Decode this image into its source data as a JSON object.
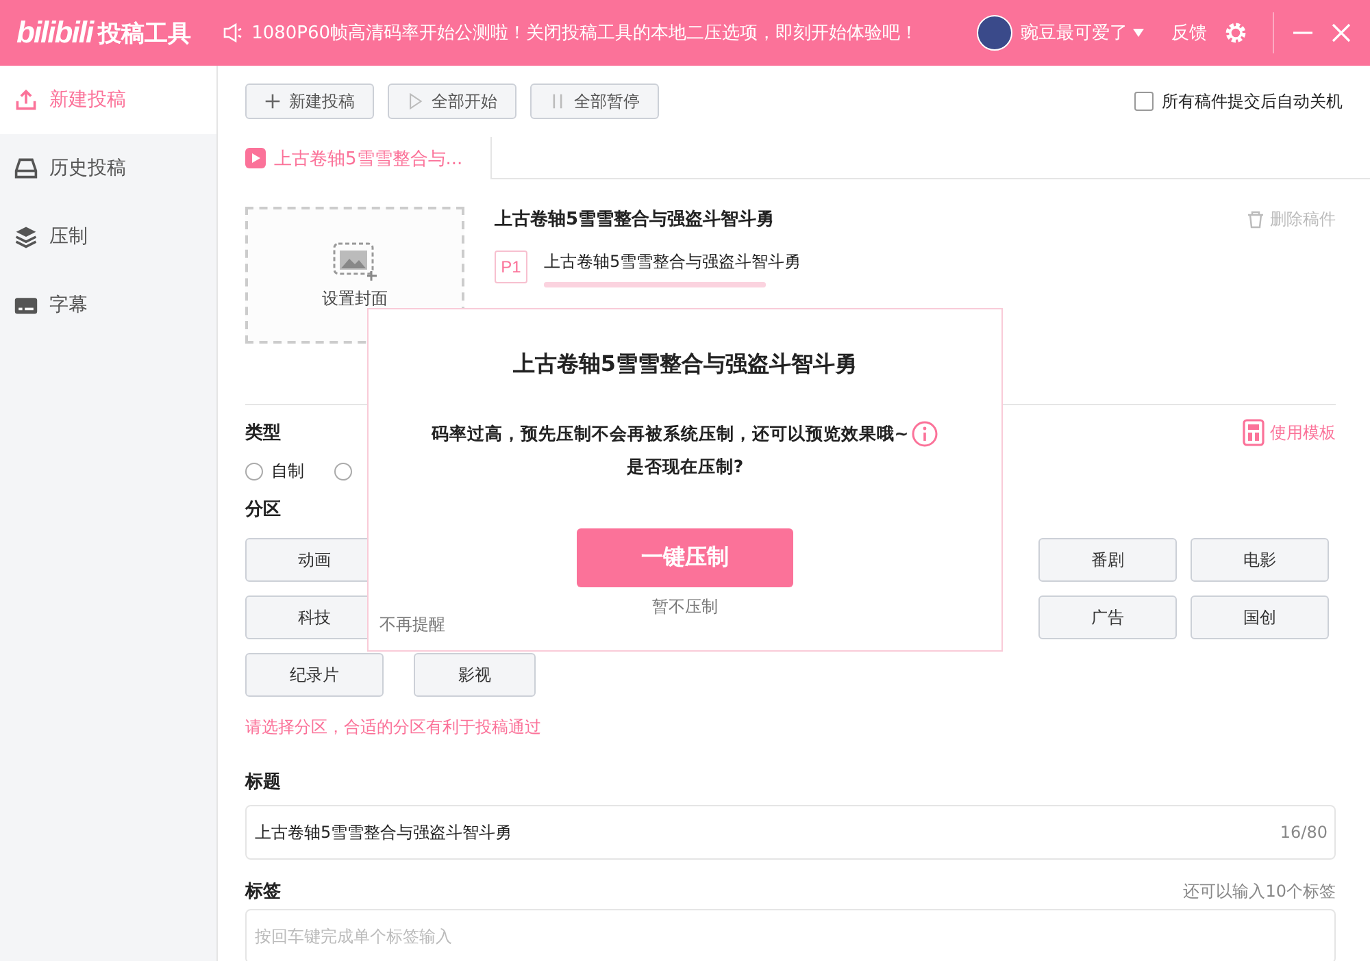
{
  "app": {
    "logo": "bilibili",
    "title": "投稿工具"
  },
  "notice": "1080P60帧高清码率开始公测啦！关闭投稿工具的本地二压选项，即刻开始体验吧！",
  "user": {
    "name": "豌豆最可爱了"
  },
  "feedback": "反馈",
  "sidebar": {
    "items": [
      {
        "label": "新建投稿",
        "selected": true
      },
      {
        "label": "历史投稿",
        "selected": false
      },
      {
        "label": "压制",
        "selected": false
      },
      {
        "label": "字幕",
        "selected": false
      }
    ]
  },
  "toolbar": {
    "buttons": [
      {
        "label": "新建投稿"
      },
      {
        "label": "全部开始"
      },
      {
        "label": "全部暂停"
      }
    ],
    "auto_shutdown": {
      "label": "所有稿件提交后自动关机",
      "checked": false
    }
  },
  "tabs": [
    {
      "label": "上古卷轴5雪雪整合与...",
      "selected": true
    }
  ],
  "draft": {
    "cover_label": "设置封面",
    "title": "上古卷轴5雪雪整合与强盗斗智斗勇",
    "delete": "删除稿件",
    "parts": [
      {
        "badge": "P1",
        "name": "上古卷轴5雪雪整合与强盗斗智斗勇",
        "level": 1
      }
    ]
  },
  "type": {
    "label": "类型",
    "template": "使用模板",
    "options": [
      {
        "label": "自制",
        "selected": false
      },
      {
        "selected": false
      }
    ]
  },
  "zone": {
    "label": "分区",
    "categories": [
      {
        "label": "动画"
      },
      {
        "label": "番剧"
      },
      {
        "label": "电影"
      },
      {
        "label": "科技"
      },
      {
        "label": "广告"
      },
      {
        "label": "国创"
      },
      {
        "label": "纪录片"
      },
      {
        "label": "影视"
      }
    ],
    "hint": "请选择分区，合适的分区有利于投稿通过"
  },
  "title_field": {
    "label": "标题",
    "value": "上古卷轴5雪雪整合与强盗斗智斗勇",
    "count": "16/80"
  },
  "tag_field": {
    "label": "标签",
    "remaining": "还可以输入10个标签",
    "placeholder": "按回车键完成单个标签输入"
  },
  "dialog": {
    "title": "上古卷轴5雪雪整合与强盗斗智斗勇",
    "message": "码率过高，预先压制不会再被系统压制，还可以预览效果哦~",
    "question": "是否现在压制?",
    "confirm": "一键压制",
    "cancel": "暂不压制",
    "dont_remind": "不再提醒"
  }
}
